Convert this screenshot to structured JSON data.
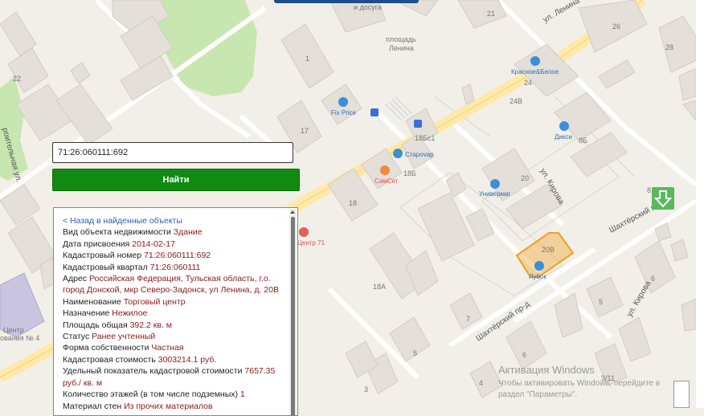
{
  "map": {
    "streets": {
      "lenina": "ул. Ленина",
      "kirova_upper": "ул. Кирова",
      "kirova_lower": "ул. Кирова",
      "shakhtersky_upper": "Шахтёрский пр-д",
      "shakhtersky_lower": "Шахтёрский пр-д",
      "stroitelnaya": "роительная ул."
    },
    "places": {
      "square_line1": "площадь",
      "square_line2": "Ленина",
      "leisure": "и досуга",
      "center_a": "Центр",
      "center_b": "ования № 4",
      "center71": "Центр 71"
    },
    "pois": {
      "fixprice": "Fix Price",
      "krasnoe": "Красное&Белое",
      "starovar": "Староvар",
      "samset": "СамСет",
      "diksi": "Дикси",
      "univermag": "Универмаг",
      "lubok": "Лубок"
    },
    "house_numbers": {
      "n21": "21",
      "n26": "26",
      "n28": "28",
      "n22": "22",
      "n1": "1",
      "n24": "24",
      "n24v": "24В",
      "n17": "17",
      "n18b1": "18Бс1",
      "n18b": "18Б",
      "n8b": "8Б",
      "n20": "20",
      "n8": "8",
      "n18": "18",
      "n20v": "20В",
      "n6": "6",
      "n18a": "18А",
      "n7": "7",
      "n5a": "5",
      "n5b": "5",
      "n6b": "6",
      "n3": "3",
      "n4": "4",
      "n3_11": "3/11"
    },
    "selected_parcel_color": "#f0a020"
  },
  "search": {
    "value": "71:26:060111:692",
    "button_label": "Найти"
  },
  "info": {
    "back_link": "< Назад в найденные объекты",
    "fields": [
      {
        "label": "Вид объекта недвижимости",
        "value": "Здание"
      },
      {
        "label": "Дата присвоения",
        "value": "2014-02-17"
      },
      {
        "label": "Кадастровый номер",
        "value": "71:26:060111:692"
      },
      {
        "label": "Кадастровый квартал",
        "value": "71:26:060111"
      },
      {
        "label": "Адрес",
        "value": "Российская Федерация, Тульская область, г.о. город Донской, мкр Северо-Задонск, ул Ленина, д. 20В"
      },
      {
        "label": "Наименование",
        "value": "Торговый центр"
      },
      {
        "label": "Назначение",
        "value": "Нежилое"
      },
      {
        "label": "Площадь общая",
        "value": "392.2 кв. м"
      },
      {
        "label": "Статус",
        "value": "Ранее учтенный"
      },
      {
        "label": "Форма собственности",
        "value": "Частная"
      },
      {
        "label": "Кадастровая стоимость",
        "value": "3003214.1 руб."
      },
      {
        "label": "Удельный показатель кадастровой стоимости",
        "value": "7657.35 руб./ кв. м"
      },
      {
        "label": "Количество этажей (в том числе подземных)",
        "value": "1"
      },
      {
        "label": "Материал стен",
        "value": "Из прочих материалов"
      }
    ]
  },
  "watermark": {
    "title": "Активация Windows",
    "line1": "Чтобы активировать Windows, перейдите в",
    "line2": "раздел \"Параметры\"."
  },
  "icons": {
    "scroll_down": "arrow-down-icon",
    "shop": "shopping-bag-icon",
    "bus": "bus-stop-icon",
    "hospital": "medical-cross-icon",
    "food": "food-icon"
  }
}
